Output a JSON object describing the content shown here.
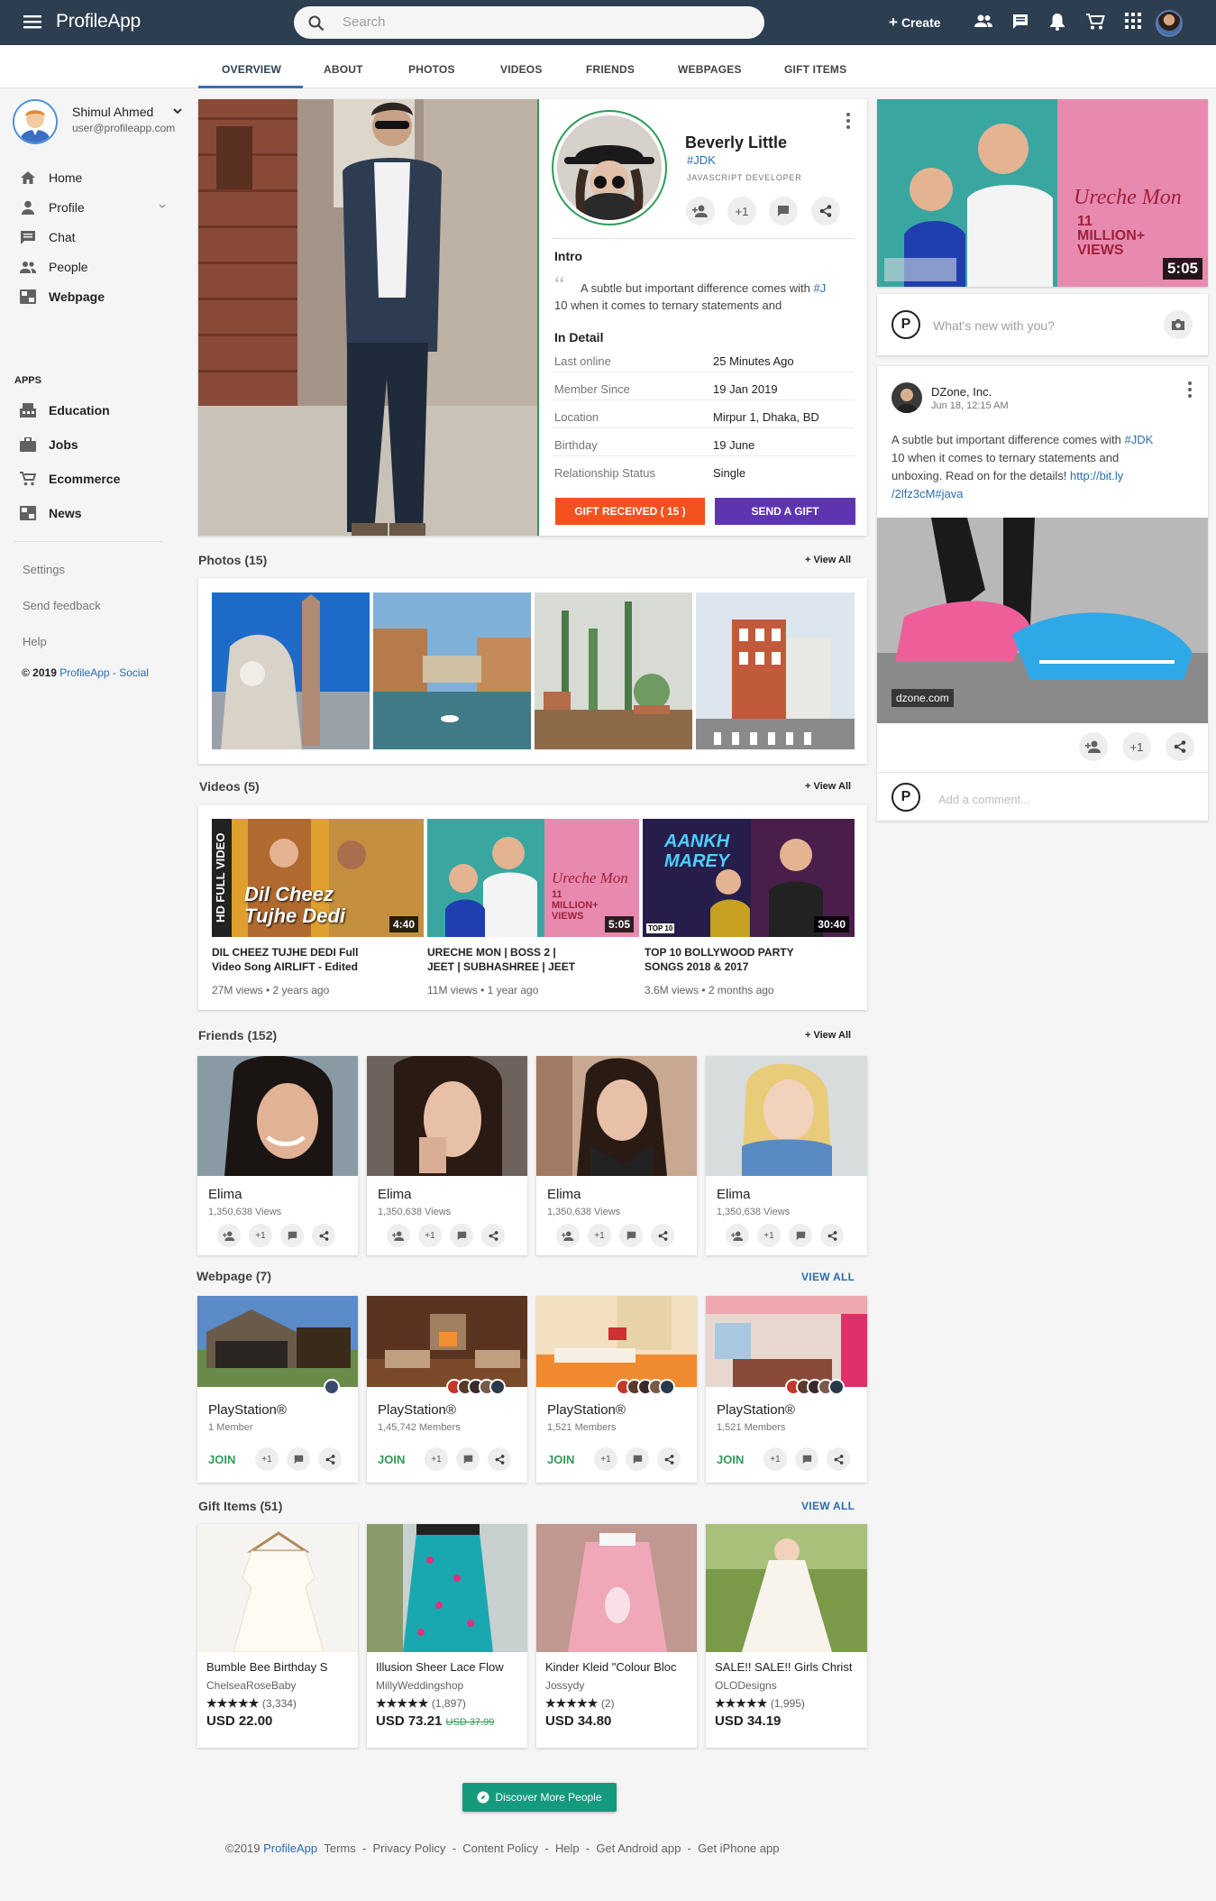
{
  "app": {
    "name": "ProfileApp",
    "search_placeholder": "Search",
    "create_label": "Create"
  },
  "tabs": [
    "OVERVIEW",
    "ABOUT",
    "PHOTOS",
    "VIDEOS",
    "FRIENDS",
    "WEBPAGES",
    "GIFT ITEMS"
  ],
  "user": {
    "name": "Shimul Ahmed",
    "email": "user@profileapp.com"
  },
  "sidebar": {
    "nav": [
      "Home",
      "Profile",
      "Chat",
      "People",
      "Webpage"
    ],
    "apps_label": "APPS",
    "apps": [
      "Education",
      "Jobs",
      "Ecommerce",
      "News"
    ],
    "links": [
      "Settings",
      "Send feedback",
      "Help"
    ],
    "copyright_prefix": "© 2019",
    "copyright_link": "ProfileApp - Social"
  },
  "profile": {
    "name": "Beverly Little",
    "tag": "#JDK",
    "role": "JAVASCRIPT DEVELOPER",
    "plus_one": "+1",
    "intro_heading": "Intro",
    "intro_text": "A subtle but important difference comes with",
    "intro_tag": "#J",
    "intro_text2": "10 when it comes to ternary statements and",
    "detail_heading": "In Detail",
    "details": [
      {
        "label": "Last online",
        "value": "25 Minutes Ago"
      },
      {
        "label": "Member Since",
        "value": "19 Jan 2019"
      },
      {
        "label": "Location",
        "value": "Mirpur 1, Dhaka, BD"
      },
      {
        "label": "Birthday",
        "value": "19 June"
      },
      {
        "label": "Relationship Status",
        "value": "Single"
      }
    ],
    "gift_received": "GIFT RECEIVED ( 15 )",
    "send_gift": "SEND A GIFT"
  },
  "photos": {
    "heading": "Photos (15)",
    "view_all": "+ View All"
  },
  "videos": {
    "heading": "Videos (5)",
    "view_all": "+ View All",
    "items": [
      {
        "title1": "DIL CHEEZ TUJHE DEDI Full",
        "title2": "Video Song AIRLIFT - Edited",
        "meta": "27M views • 2 years ago",
        "duration": "4:40",
        "overlay": "Dil Cheez Tujhe Dedi",
        "badge": "HD FULL VIDEO"
      },
      {
        "title1": "URECHE MON | BOSS 2 |",
        "title2": "JEET | SUBHASHREE | JEET",
        "meta": "11M views • 1 year ago",
        "duration": "5:05",
        "overlay": "Ureche Mon",
        "badge": "11 MILLION+ VIEWS"
      },
      {
        "title1": "TOP 10 BOLLYWOOD PARTY",
        "title2": "SONGS 2018 & 2017",
        "meta": "3.6M views • 2 months ago",
        "duration": "30:40",
        "overlay": "AANKH MAREY",
        "badge": "TOP 10"
      }
    ]
  },
  "friends": {
    "heading": "Friends (152)",
    "view_all": "+ View All",
    "items": [
      {
        "name": "Elima",
        "views": "1,350,638 Views"
      },
      {
        "name": "Elima",
        "views": "1,350,638 Views"
      },
      {
        "name": "Elima",
        "views": "1,350,638 Views"
      },
      {
        "name": "Elima",
        "views": "1,350,638 Views"
      }
    ]
  },
  "webpages": {
    "heading": "Webpage (7)",
    "view_all": "VIEW ALL",
    "join": "JOIN",
    "items": [
      {
        "name": "PlayStation®",
        "members": "1 Member"
      },
      {
        "name": "PlayStation®",
        "members": "1,45,742 Members"
      },
      {
        "name": "PlayStation®",
        "members": "1,521 Members"
      },
      {
        "name": "PlayStation®",
        "members": "1,521 Members"
      }
    ]
  },
  "gifts": {
    "heading": "Gift Items (51)",
    "view_all": "VIEW ALL",
    "items": [
      {
        "title": "Bumble Bee Birthday S",
        "shop": "ChelseaRoseBaby",
        "stars": "★★★★★",
        "count": "(3,334)",
        "price": "USD 22.00",
        "old": ""
      },
      {
        "title": "Illusion Sheer Lace Flow",
        "shop": "MillyWeddingshop",
        "stars": "★★★★★",
        "count": "(1,897)",
        "price": "USD 73.21",
        "old": "USD 37.99"
      },
      {
        "title": "Kinder Kleid \"Colour Bloc",
        "shop": "Jossydy",
        "stars": "★★★★★",
        "count": "(2)",
        "price": "USD 34.80",
        "old": ""
      },
      {
        "title": "SALE!! SALE!! Girls Christ",
        "shop": "OLODesigns",
        "stars": "★★★★★",
        "count": "(1,995)",
        "price": "USD 34.19",
        "old": ""
      }
    ]
  },
  "right": {
    "video_duration": "5:05",
    "video_overlay": "Ureche Mon",
    "video_badge": "11 MILLION+ VIEWS",
    "post_placeholder": "What's new with you?",
    "post": {
      "author": "DZone, Inc.",
      "time": "Jun 18, 12:15 AM",
      "text1": "A subtle but important difference comes with",
      "tag": "#JDK",
      "text2": "10 when it comes to ternary statements and",
      "text3": "unboxing. Read on for the details!",
      "link1": "http://bit.ly",
      "link2": "/2lfz3cM",
      "hashtag": "#java",
      "domain": "dzone.com",
      "plus_one": "+1"
    },
    "comment_placeholder": "Add a comment..."
  },
  "discover": "Discover More People",
  "footer": {
    "copy": "©2019",
    "brand": "ProfileApp",
    "links": [
      "Terms",
      "Privacy Policy",
      "Content Policy",
      "Help",
      "Get Android app",
      "Get iPhone app"
    ]
  }
}
